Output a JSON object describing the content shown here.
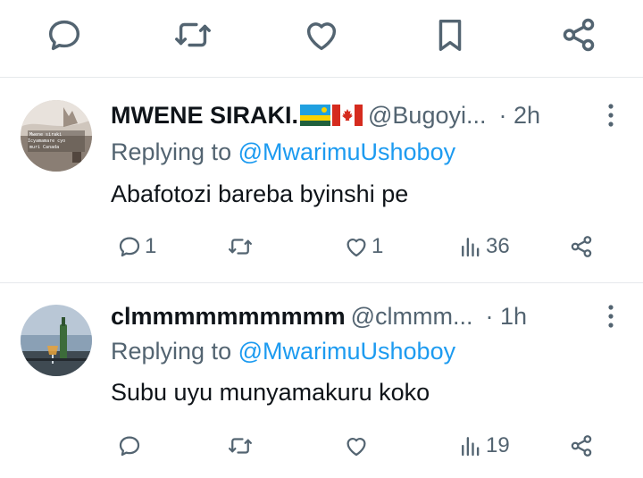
{
  "top_actions": [
    "reply-icon",
    "retweet-icon",
    "like-icon",
    "bookmark-icon",
    "share-icon"
  ],
  "colors": {
    "icon": "#536471",
    "text": "#0f1419",
    "secondary": "#536471",
    "link": "#1d9bf0",
    "divider": "#e6e9ec"
  },
  "tweets": [
    {
      "name": "MWENE SIRAKI.",
      "flags": [
        "rwanda-flag",
        "canada-flag"
      ],
      "handle": "@Bugoyi...",
      "time": "· 2h",
      "replying_label": "Replying to",
      "replying_to": "@MwarimuUshoboy",
      "text": "Abafotozi bareba byinshi pe",
      "replies": "1",
      "retweets": "",
      "likes": "1",
      "views": "36",
      "avatar_text": "Mwene siraki Icyamamare cyo muri Canada"
    },
    {
      "name": "clmmmmmmmmmm",
      "handle": "@clmmm...",
      "time": "· 1h",
      "replying_label": "Replying to",
      "replying_to": "@MwarimuUshoboy",
      "text": "Subu uyu munyamakuru koko",
      "replies": "",
      "retweets": "",
      "likes": "",
      "views": "19"
    }
  ]
}
